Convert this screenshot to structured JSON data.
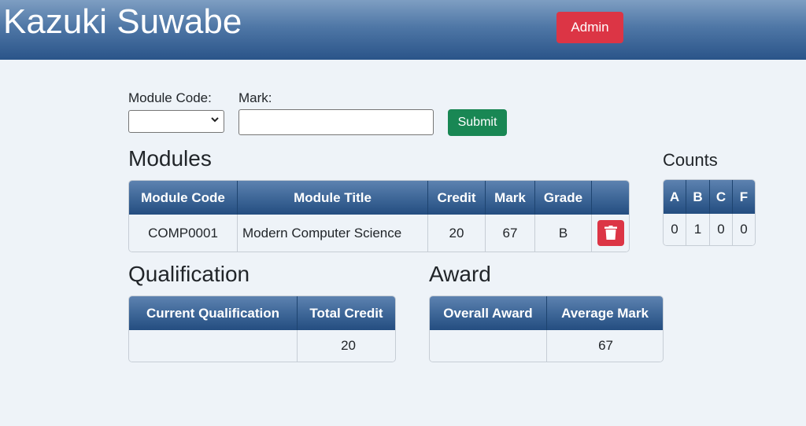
{
  "header": {
    "title": "Kazuki Suwabe",
    "admin_label": "Admin"
  },
  "form": {
    "module_code_label": "Module Code:",
    "module_code_value": "",
    "mark_label": "Mark:",
    "mark_value": "",
    "submit_label": "Submit"
  },
  "modules": {
    "heading": "Modules",
    "columns": [
      "Module Code",
      "Module Title",
      "Credit",
      "Mark",
      "Grade"
    ],
    "rows": [
      {
        "code": "COMP0001",
        "title": "Modern Computer Science",
        "credit": "20",
        "mark": "67",
        "grade": "B",
        "delete_icon": "trash-icon"
      }
    ]
  },
  "counts": {
    "heading": "Counts",
    "columns": [
      "A",
      "B",
      "C",
      "F"
    ],
    "values": [
      "0",
      "1",
      "0",
      "0"
    ]
  },
  "qualification": {
    "heading": "Qualification",
    "columns": [
      "Current Qualification",
      "Total Credit"
    ],
    "values": [
      "",
      "20"
    ]
  },
  "award": {
    "heading": "Award",
    "columns": [
      "Overall Award",
      "Average Mark"
    ],
    "values": [
      "",
      "67"
    ]
  },
  "colors": {
    "header_gradient": [
      "#7e9ec2",
      "#2a5489"
    ],
    "danger": "#dc3545",
    "success": "#198754",
    "background": "#eef3f8"
  }
}
